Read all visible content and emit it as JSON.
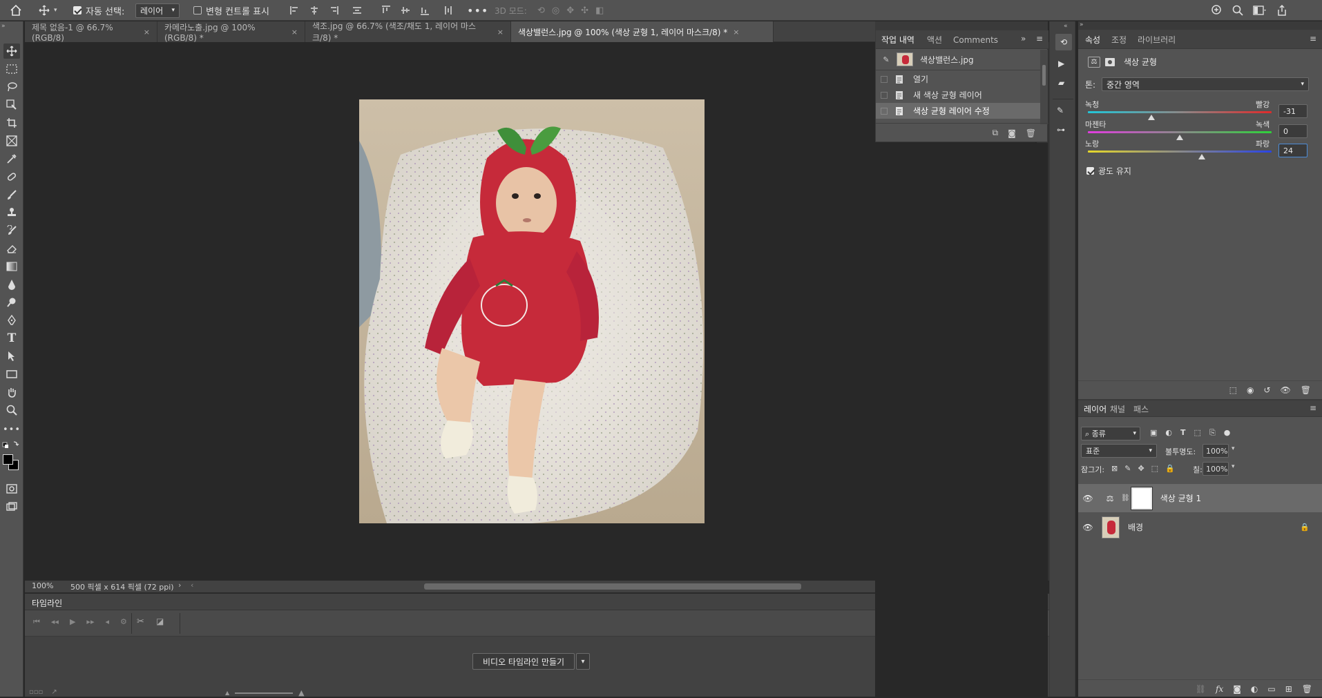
{
  "optbar": {
    "auto_select_label": "자동 선택:",
    "auto_select_value": "레이어",
    "transform_controls_label": "변형 컨트롤 표시",
    "mode_3d_label": "3D 모드:"
  },
  "tabs": [
    {
      "label": "제목 없음-1 @ 66.7% (RGB/8)",
      "close": "×"
    },
    {
      "label": "카메라노출.jpg @ 100% (RGB/8) *",
      "close": "×"
    },
    {
      "label": "색조.jpg @ 66.7% (색조/채도 1, 레이어 마스크/8) *",
      "close": "×"
    },
    {
      "label": "색상밸런스.jpg @ 100% (색상 균형 1, 레이어 마스크/8) *",
      "close": "×"
    }
  ],
  "status": {
    "zoom": "100%",
    "doc_info": "500 픽셀 x 614 픽셀 (72 ppi)"
  },
  "timeline": {
    "title": "타임라인",
    "create_button": "비디오 타임라인 만들기"
  },
  "history": {
    "tabs": [
      "작업 내역",
      "액션",
      "Comments"
    ],
    "snapshot": "색상밸런스.jpg",
    "items": [
      "열기",
      "새 색상 균형 레이어",
      "색상 균형 레이어 수정"
    ]
  },
  "properties": {
    "tabs": [
      "속성",
      "조정",
      "라이브러리"
    ],
    "title": "색상 균형",
    "tone_label": "톤:",
    "tone_value": "중간 영역",
    "sliders": [
      {
        "left": "녹청",
        "right": "빨강",
        "value": "-31",
        "level": -31
      },
      {
        "left": "마젠타",
        "right": "녹색",
        "value": "0",
        "level": 0
      },
      {
        "left": "노랑",
        "right": "파랑",
        "value": "24",
        "level": 24
      }
    ],
    "preserve_luminosity": "광도 유지"
  },
  "layers_panel": {
    "tabs": [
      "레이어",
      "채널",
      "패스"
    ],
    "filter_kind": "종류",
    "blend_mode": "표준",
    "opacity_label": "불투명도:",
    "opacity_value": "100%",
    "lock_label": "잠그기:",
    "fill_label": "칠:",
    "fill_value": "100%",
    "layers": [
      {
        "name": "색상 균형 1"
      },
      {
        "name": "배경"
      }
    ]
  },
  "colors": {
    "accent_selection": "#6a6a6a",
    "photo_red": "#c62a3a"
  }
}
